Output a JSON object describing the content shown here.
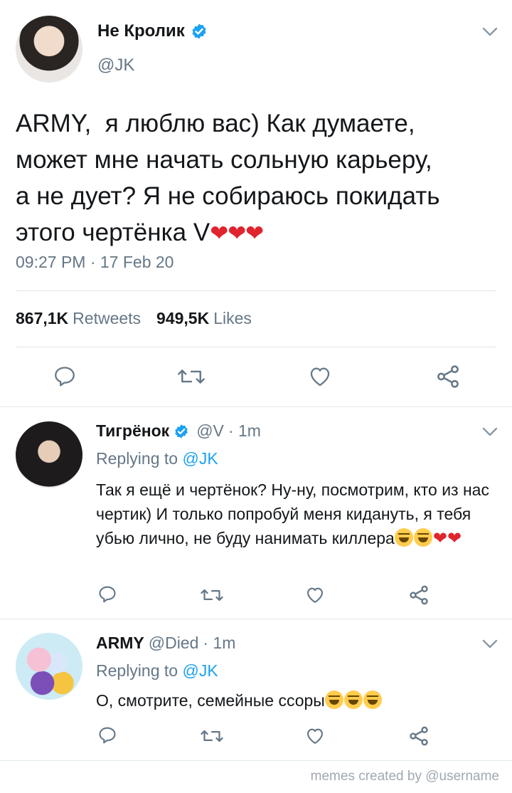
{
  "main_tweet": {
    "name": "Не Кролик",
    "handle": "@JK",
    "text": "ARMY,  я люблю вас) Как думаете,\nможет мне начать сольную карьеру,\nа не дует? Я не собираюсь покидать\nэтого чертёнка V",
    "text_emoji": "❤❤❤",
    "timestamp": "09:27 PM · 17 Feb 20",
    "retweets_count": "867,1K",
    "retweets_label": "Retweets",
    "likes_count": "949,5K",
    "likes_label": "Likes"
  },
  "replies": [
    {
      "name": "Тигрёнок",
      "handle": "@V",
      "time": "· 1m",
      "replying_prefix": "Replying to",
      "replying_to": "@JK",
      "text": "Так я ещё и чертёнок? Ну-ну, посмотрим, кто из нас чертик) И только попробуй меня кидануть, я тебя убью лично, не буду нанимать киллера",
      "hearts": "❤❤"
    },
    {
      "name": "ARMY",
      "handle": "@Died",
      "time": "· 1m",
      "replying_prefix": "Replying to",
      "replying_to": "@JK",
      "text": "О, смотрите, семейные ссоры"
    }
  ],
  "footer": "memes created by @username",
  "colors": {
    "accent": "#1da1f2",
    "text": "#14171a",
    "muted": "#657786",
    "icon": "#657786",
    "divider": "#e1e8ed"
  },
  "icons": [
    "verified-icon",
    "chevron-down-icon",
    "reply-icon",
    "retweet-icon",
    "like-icon",
    "share-icon"
  ]
}
